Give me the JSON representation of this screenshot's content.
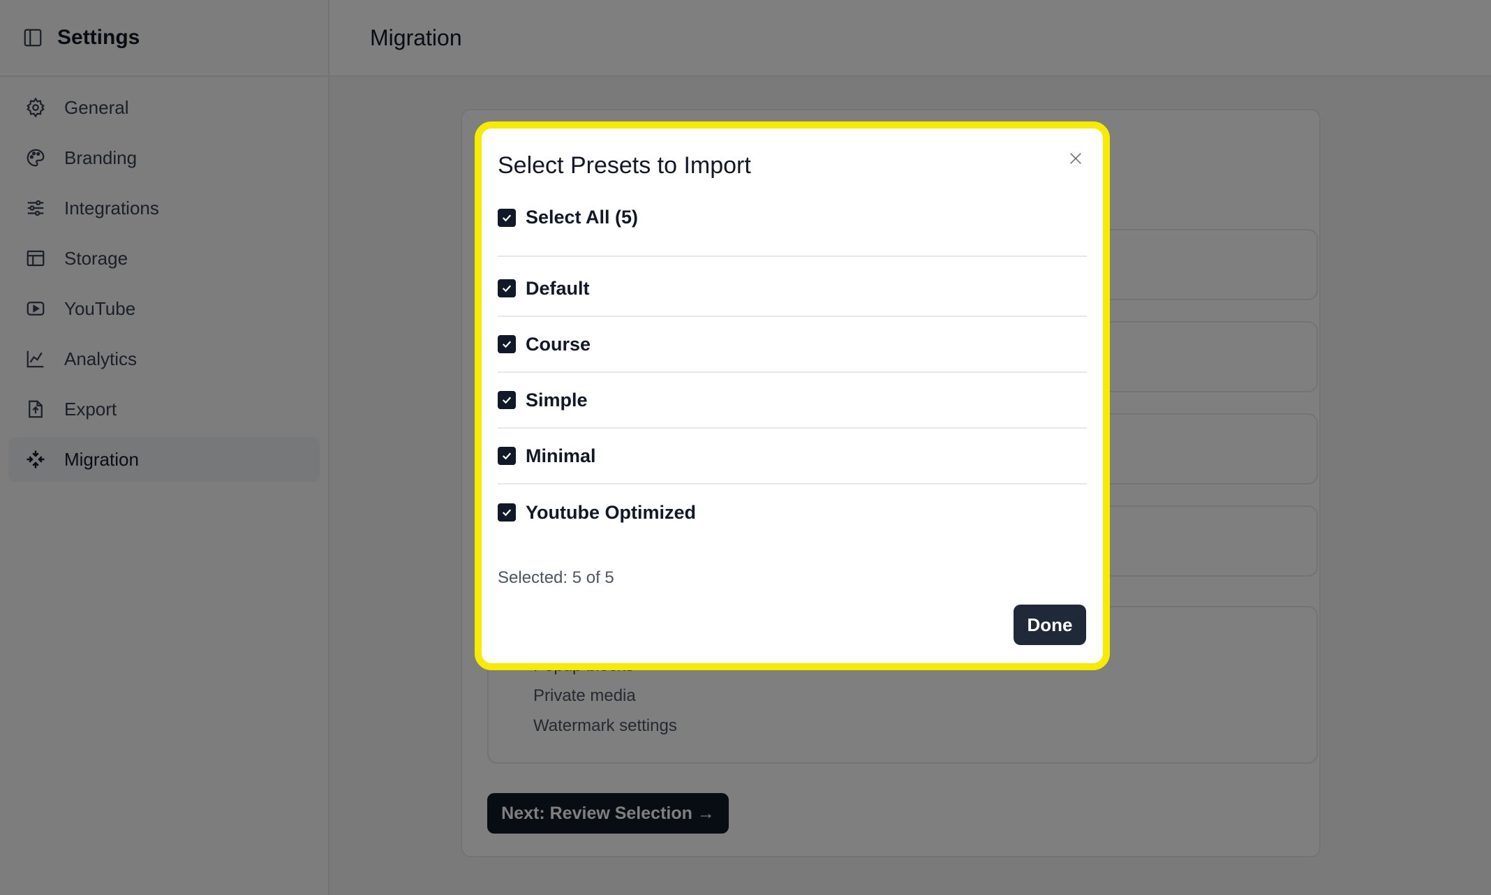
{
  "sidebar": {
    "title": "Settings",
    "items": [
      {
        "label": "General",
        "icon": "gear-icon"
      },
      {
        "label": "Branding",
        "icon": "palette-icon"
      },
      {
        "label": "Integrations",
        "icon": "sliders-icon"
      },
      {
        "label": "Storage",
        "icon": "storage-icon"
      },
      {
        "label": "YouTube",
        "icon": "play-icon"
      },
      {
        "label": "Analytics",
        "icon": "chart-icon"
      },
      {
        "label": "Export",
        "icon": "export-icon"
      },
      {
        "label": "Migration",
        "icon": "migration-icon",
        "active": true
      }
    ]
  },
  "header": {
    "title": "Migration"
  },
  "background": {
    "list_items": [
      "Popup blocks",
      "Private media",
      "Watermark settings"
    ],
    "next_button": "Next: Review Selection →"
  },
  "modal": {
    "title": "Select Presets to Import",
    "select_all_label": "Select All (5)",
    "presets": [
      "Default",
      "Course",
      "Simple",
      "Minimal",
      "Youtube Optimized"
    ],
    "selected_text": "Selected: 5 of 5",
    "done_label": "Done",
    "highlight_color": "#f7ec00"
  }
}
